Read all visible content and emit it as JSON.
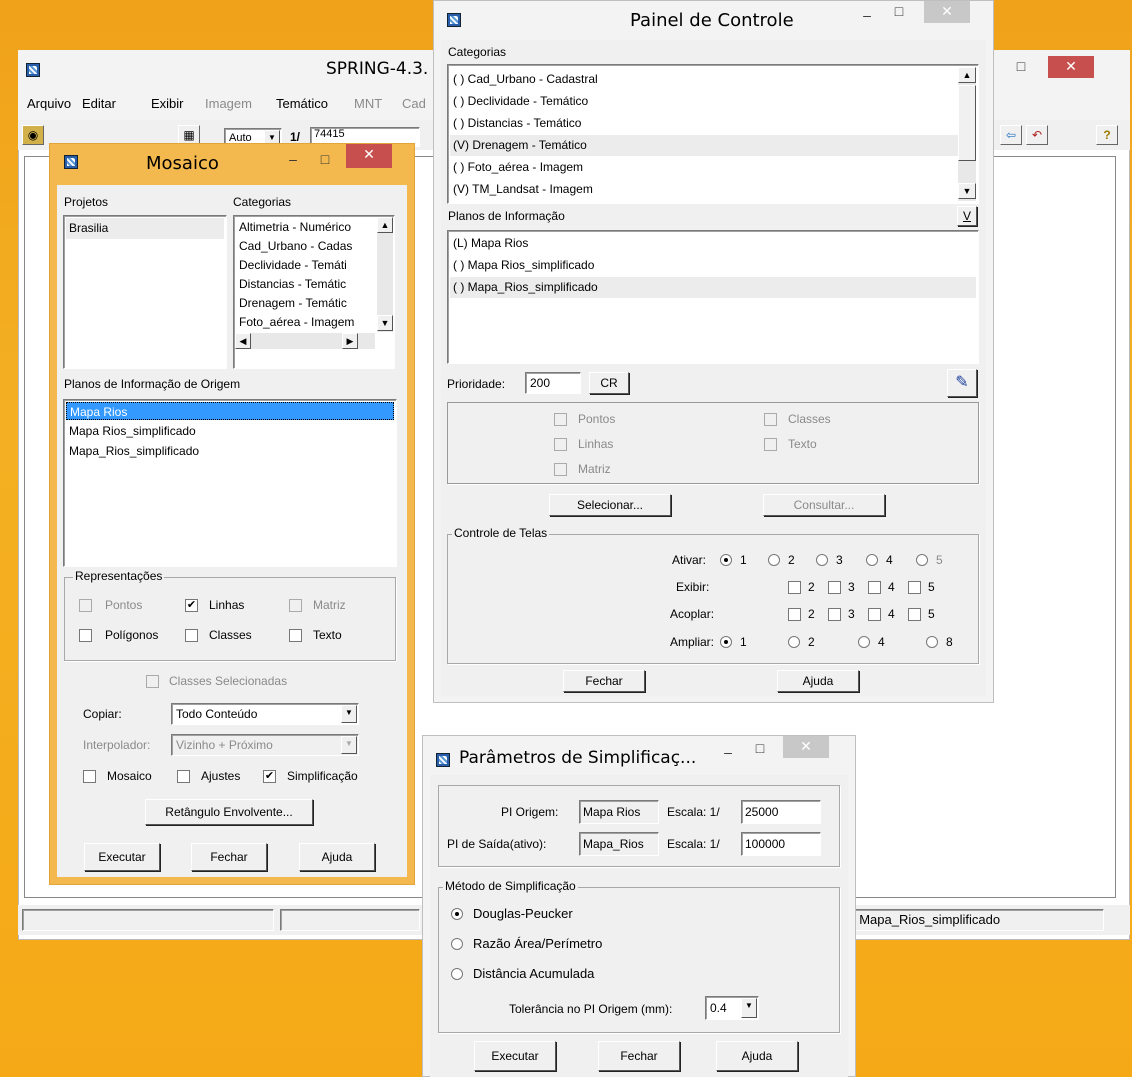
{
  "spring": {
    "title": "SPRING-4.3.",
    "menu": [
      "Arquivo",
      "Editar",
      "Exibir",
      "Imagem",
      "Temático",
      "MNT",
      "Cad"
    ],
    "toolbar": {
      "zoom_mode": "Auto",
      "scale_prefix": "1/",
      "scale_value": "74415"
    },
    "status_right": ": Mapa_Rios_simplificado"
  },
  "mosaico": {
    "title": "Mosaico",
    "projetos_label": "Projetos",
    "projetos": [
      "Brasilia"
    ],
    "categorias_label": "Categorias",
    "categorias": [
      "Altimetria - Numérico",
      "Cad_Urbano - Cadas",
      "Declividade - Temáti",
      "Distancias - Temátic",
      "Drenagem - Temátic",
      "Foto_aérea - Imagem"
    ],
    "planos_label": "Planos de Informação de Origem",
    "planos": [
      "Mapa Rios",
      "Mapa Rios_simplificado",
      "Mapa_Rios_simplificado"
    ],
    "selected_plano": 0,
    "representacoes_label": "Representações",
    "rep": {
      "pontos": "Pontos",
      "linhas": "Linhas",
      "matriz": "Matriz",
      "poligonos": "Polígonos",
      "classes": "Classes",
      "texto": "Texto"
    },
    "classes_selecionadas": "Classes Selecionadas",
    "copiar_label": "Copiar:",
    "copiar_value": "Todo Conteúdo",
    "interpolador_label": "Interpolador:",
    "interpolador_value": "Vizinho + Próximo",
    "opt_mosaico": "Mosaico",
    "opt_ajustes": "Ajustes",
    "opt_simplificacao": "Simplificação",
    "retangulo": "Retângulo Envolvente...",
    "executar": "Executar",
    "fechar": "Fechar",
    "ajuda": "Ajuda"
  },
  "painel": {
    "title": "Painel de Controle",
    "categorias_label": "Categorias",
    "categorias": [
      "( ) Cad_Urbano - Cadastral",
      "( ) Declividade - Temático",
      "( ) Distancias - Temático",
      "(V) Drenagem - Temático",
      "( ) Foto_aérea - Imagem",
      "(V) TM_Landsat - Imagem"
    ],
    "planos_label": "Planos de Informação",
    "planos_v": "V",
    "planos": [
      "(L) Mapa Rios",
      "( ) Mapa Rios_simplificado",
      "( ) Mapa_Rios_simplificado"
    ],
    "prioridade_label": "Prioridade:",
    "prioridade_value": "200",
    "cr": "CR",
    "rep": {
      "pontos": "Pontos",
      "linhas": "Linhas",
      "matriz": "Matriz",
      "classes": "Classes",
      "texto": "Texto"
    },
    "selecionar": "Selecionar...",
    "consultar": "Consultar...",
    "controle_telas": "Controle de Telas",
    "ativar": "Ativar:",
    "exibir": "Exibir:",
    "acoplar": "Acoplar:",
    "ampliar": "Ampliar:",
    "n1": "1",
    "n2": "2",
    "n3": "3",
    "n4": "4",
    "n5": "5",
    "n8": "8",
    "fechar": "Fechar",
    "ajuda": "Ajuda"
  },
  "params": {
    "title": "Parâmetros de Simplificaç...",
    "pi_origem_label": "PI Origem:",
    "pi_origem_value": "Mapa Rios",
    "escala_label": "Escala: 1/",
    "escala_origem": "25000",
    "pi_saida_label": "PI de Saída(ativo):",
    "pi_saida_value": "Mapa_Rios",
    "escala_saida": "100000",
    "metodo_label": "Método de Simplificação",
    "metodos": [
      "Douglas-Peucker",
      "Razão Área/Perímetro",
      "Distância Acumulada"
    ],
    "tolerancia_label": "Tolerância no PI Origem (mm):",
    "tolerancia_value": "0.4",
    "executar": "Executar",
    "fechar": "Fechar",
    "ajuda": "Ajuda"
  }
}
